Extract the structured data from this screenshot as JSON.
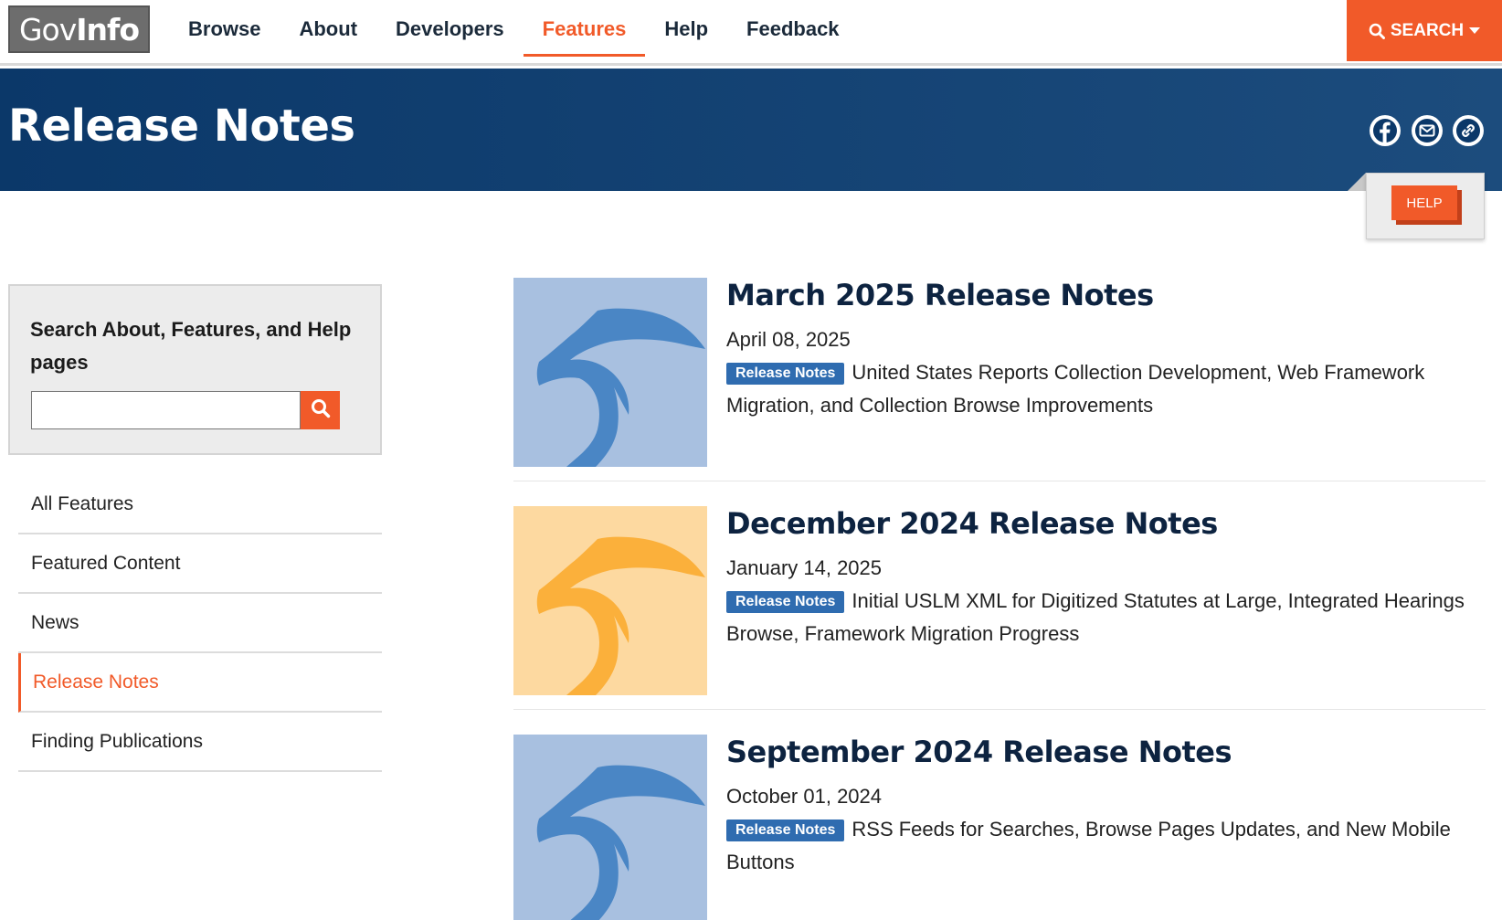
{
  "header": {
    "logo_text_thin": "Gov",
    "logo_text_bold": "Info",
    "nav": [
      {
        "label": "Browse"
      },
      {
        "label": "About"
      },
      {
        "label": "Developers"
      },
      {
        "label": "Features"
      },
      {
        "label": "Help"
      },
      {
        "label": "Feedback"
      }
    ],
    "active_nav": "Features",
    "search_label": "SEARCH"
  },
  "banner": {
    "title": "Release Notes",
    "share_icons": [
      "facebook-icon",
      "email-icon",
      "link-icon"
    ]
  },
  "help_tab": {
    "label": "HELP"
  },
  "sidebar": {
    "search_label": "Search About, Features, and Help pages",
    "search_value": "",
    "items": [
      {
        "label": "All Features"
      },
      {
        "label": "Featured Content"
      },
      {
        "label": "News"
      },
      {
        "label": "Release Notes"
      },
      {
        "label": "Finding Publications"
      }
    ],
    "active_item": "Release Notes"
  },
  "articles": [
    {
      "title": "March 2025 Release Notes",
      "date": "April 08, 2025",
      "badge": "Release Notes",
      "description": "United States Reports Collection Development, Web Framework Migration, and Collection Browse Improvements",
      "thumb_bg": "#a8c0e0",
      "thumb_fg": "#4a86c5"
    },
    {
      "title": "December 2024 Release Notes",
      "date": "January 14, 2025",
      "badge": "Release Notes",
      "description": "Initial USLM XML for Digitized Statutes at Large, Integrated Hearings Browse, Framework Migration Progress",
      "thumb_bg": "#fdd9a0",
      "thumb_fg": "#fbb03b"
    },
    {
      "title": "September 2024 Release Notes",
      "date": "October 01, 2024",
      "badge": "Release Notes",
      "description": "RSS Feeds for Searches, Browse Pages Updates, and New Mobile Buttons",
      "thumb_bg": "#a8c0e0",
      "thumb_fg": "#4a86c5"
    }
  ],
  "colors": {
    "accent": "#f15a29",
    "banner": "#0b3869",
    "badge": "#2f6cb0"
  }
}
